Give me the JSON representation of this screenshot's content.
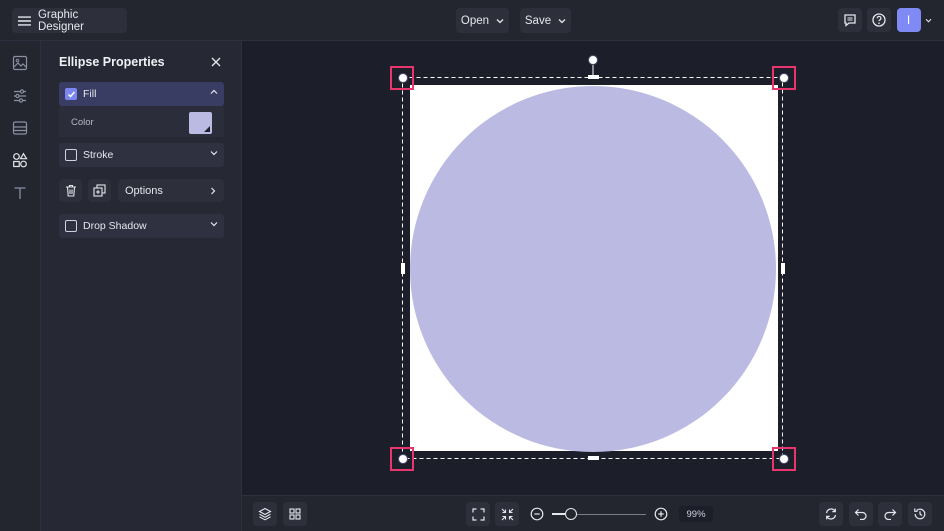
{
  "app": {
    "title": "Graphic Designer"
  },
  "header": {
    "open_label": "Open",
    "save_label": "Save",
    "avatar_initial": "I"
  },
  "panel": {
    "title": "Ellipse Properties",
    "fill": {
      "label": "Fill",
      "checked": true,
      "color_label": "Color",
      "color_value": "#bbbae3"
    },
    "stroke": {
      "label": "Stroke",
      "checked": false
    },
    "options_label": "Options",
    "drop_shadow": {
      "label": "Drop Shadow",
      "checked": false
    }
  },
  "canvas": {
    "background": "#ffffff",
    "ellipse_color": "#bbbae3",
    "highlight_color": "#e8356d"
  },
  "bottom": {
    "zoom_value": "99",
    "zoom_unit": "%"
  },
  "sidebar": {
    "icons": [
      "image-icon",
      "adjust-icon",
      "layout-icon",
      "shapes-icon",
      "text-icon"
    ]
  }
}
